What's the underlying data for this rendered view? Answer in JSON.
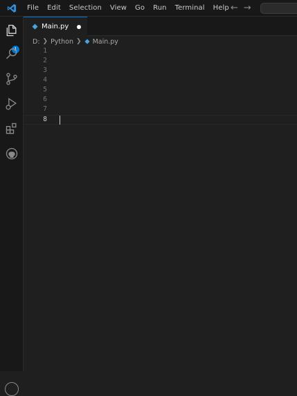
{
  "titlebar": {
    "logo_icon": "vscode-logo-icon",
    "menu": [
      "File",
      "Edit",
      "Selection",
      "View",
      "Go",
      "Run",
      "Terminal",
      "Help"
    ],
    "back_arrow": "←",
    "forward_arrow": "→"
  },
  "activity_bar": {
    "items": [
      "explorer-icon",
      "search-icon",
      "source-control-icon",
      "run-debug-icon",
      "extensions-icon",
      "github-icon"
    ],
    "explorer_badge": "1",
    "accent_color": "#0078d4"
  },
  "tab": {
    "label": "Main.py",
    "file_icon": "python-file-icon",
    "modified": true
  },
  "breadcrumb": {
    "parts": [
      "D:",
      "Python",
      "Main.py"
    ]
  },
  "editor": {
    "line_numbers": [
      "1",
      "2",
      "3",
      "4",
      "5",
      "6",
      "7",
      "8"
    ],
    "active_line": 8
  }
}
